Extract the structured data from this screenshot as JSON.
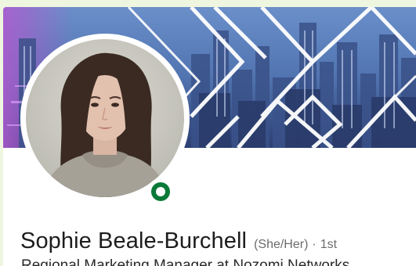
{
  "profile": {
    "name": "Sophie Beale-Burchell",
    "pronouns": "(She/Her)",
    "separator": "·",
    "connection_degree": "1st",
    "headline": "Regional Marketing Manager at Nozomi Networks",
    "status": "open-to-work-indicator"
  },
  "colors": {
    "page_background": "#eef6e0",
    "status_green": "#0a7a37",
    "banner_primary": "#4a6fa8",
    "name_text": "#1d1d1d",
    "muted_text": "#6b6b6b"
  },
  "icons": {
    "status": "online-status-icon"
  }
}
